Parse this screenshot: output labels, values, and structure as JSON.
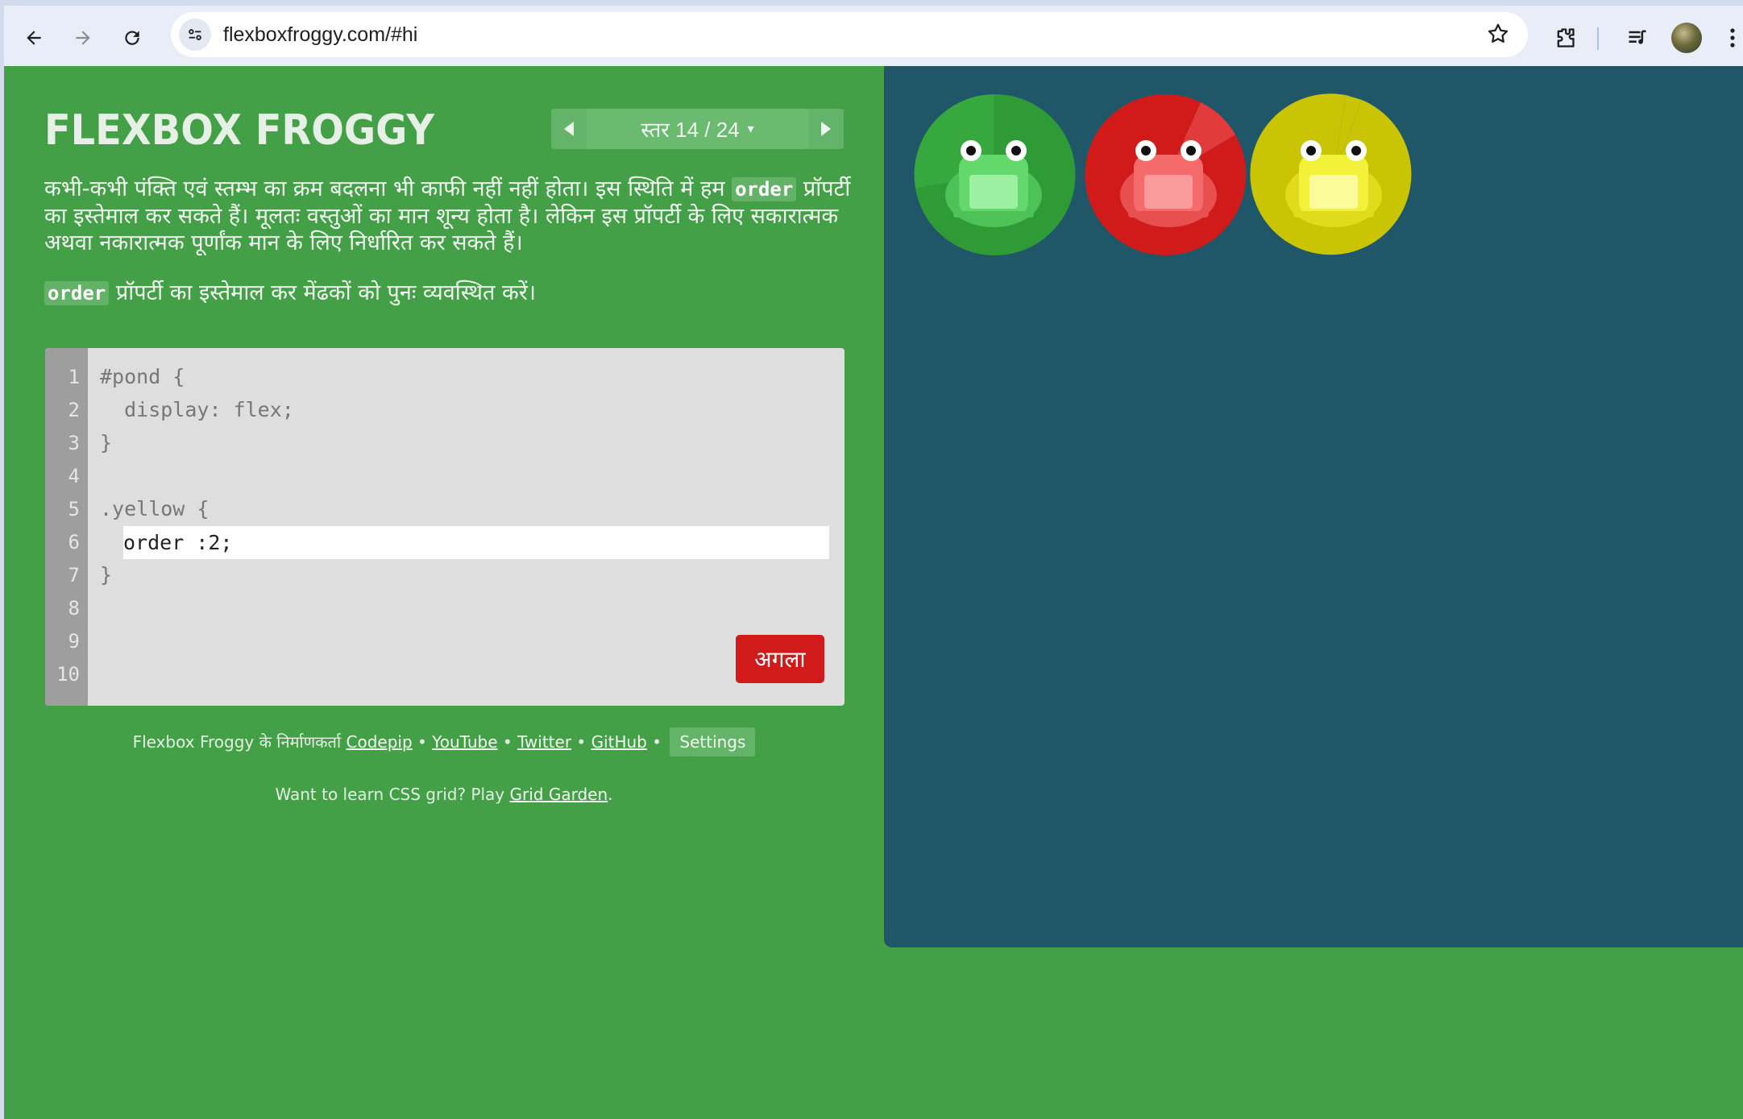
{
  "browser": {
    "url": "flexboxfroggy.com/#hi"
  },
  "header": {
    "logo": "FLEXBOX FROGGY",
    "level_label": "स्तर 14 / 24",
    "dropdown_caret": "▾"
  },
  "instructions": {
    "p1_before": "कभी-कभी पंक्ति एवं स्तम्भ का क्रम बदलना भी काफी नहीं नहीं होता। इस स्थिति में हम ",
    "p1_code": "order",
    "p1_after_line1": " प्रॉपर्टी",
    "p1_line2": "का इस्तेमाल कर सकते हैं। मूलतः वस्तुओं का मान शून्य होता है। लेकिन इस प्रॉपर्टी के लिए सकारात्मक",
    "p1_line3": "अथवा नकारात्मक पूर्णांक मान के लिए निर्धारित कर सकते हैं।",
    "p2_code": "order",
    "p2_text": " प्रॉपर्टी का इस्तेमाल कर मेंढकों को पुनः व्यवस्थित करें।"
  },
  "editor": {
    "line_numbers": [
      "1",
      "2",
      "3",
      "4",
      "5",
      "6",
      "7",
      "8",
      "9",
      "10"
    ],
    "code_lines": [
      "#pond {",
      "  display: flex;",
      "}",
      "",
      ".yellow {",
      "",
      "}"
    ],
    "input_value": "order :2;",
    "next_label": "अगला"
  },
  "footer": {
    "credits_prefix": "Flexbox Froggy के निर्माणकर्ता",
    "links": [
      "Codepip",
      "YouTube",
      "Twitter",
      "GitHub"
    ],
    "separator": "•",
    "settings_label": "Settings",
    "promo_prefix": "Want to learn CSS grid? Play ",
    "promo_link": "Grid Garden",
    "promo_suffix": "."
  },
  "pond": {
    "frogs": [
      {
        "color": "green",
        "pad": "#2e9b36",
        "body": "#63d86b",
        "belly": "#9df0a2"
      },
      {
        "color": "red",
        "pad": "#d11b1b",
        "body": "#f56a6a",
        "belly": "#f99b9b"
      },
      {
        "color": "yellow",
        "pad": "#c9c504",
        "body": "#f2f23a",
        "belly": "#fbfb9a"
      }
    ]
  },
  "colors": {
    "page_bg": "#43a047",
    "pond_bg": "#1f5768",
    "next_button": "#d11b1b"
  }
}
